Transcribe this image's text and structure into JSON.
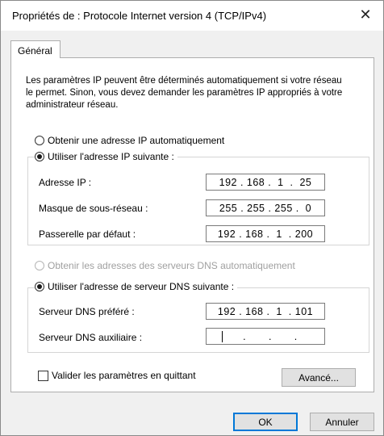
{
  "window": {
    "title": "Propriétés de : Protocole Internet version 4 (TCP/IPv4)",
    "close_glyph": "✕"
  },
  "tabs": [
    {
      "label": "Général"
    }
  ],
  "description": "Les paramètres IP peuvent être déterminés automatiquement si votre réseau le permet. Sinon, vous devez demander les paramètres IP appropriés à votre administrateur réseau.",
  "ip": {
    "auto_label": "Obtenir une adresse IP automatiquement",
    "manual_label": "Utiliser l'adresse IP suivante :",
    "selected": "manual",
    "fields": [
      {
        "label": "Adresse IP :",
        "value": "192 . 168 .  1  .  25"
      },
      {
        "label": "Masque de sous-réseau :",
        "value": "255 . 255 . 255 .  0"
      },
      {
        "label": "Passerelle par défaut :",
        "value": "192 . 168 .  1  . 200"
      }
    ]
  },
  "dns": {
    "auto_label": "Obtenir les adresses des serveurs DNS automatiquement",
    "manual_label": "Utiliser l'adresse de serveur DNS suivante :",
    "selected": "manual",
    "fields": [
      {
        "label": "Serveur DNS préféré :",
        "value": "192 . 168 .  1  . 101"
      },
      {
        "label": "Serveur DNS auxiliaire :",
        "value": "   .       .       ."
      }
    ]
  },
  "validate_label": "Valider les paramètres en quittant",
  "advanced_label": "Avancé...",
  "ok_label": "OK",
  "cancel_label": "Annuler",
  "colors": {
    "accent": "#0078d7",
    "panel_bg": "#ffffff",
    "window_bg": "#f0f0f0",
    "disabled_text": "#a0a0a0"
  }
}
